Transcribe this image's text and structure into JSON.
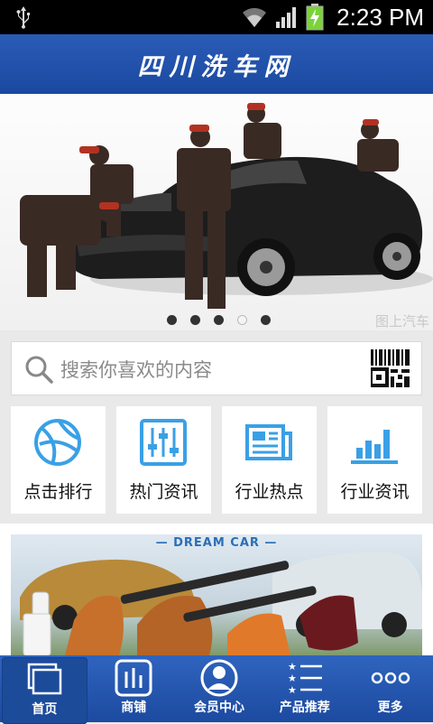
{
  "status_bar": {
    "time": "2:23 PM",
    "icons": [
      "usb-icon",
      "wifi-icon",
      "signal-icon",
      "battery-charging-icon"
    ]
  },
  "header": {
    "title": "四川洗车网"
  },
  "banner": {
    "watermark": "图上汽车",
    "slide_count": 5,
    "active_slide": 4
  },
  "search": {
    "placeholder": "搜索你喜欢的内容",
    "icon": "search-icon",
    "scan_icon": "qr-scan-icon"
  },
  "quick_links": [
    {
      "label": "点击排行",
      "icon": "basketball-icon"
    },
    {
      "label": "热门资讯",
      "icon": "sliders-icon"
    },
    {
      "label": "行业热点",
      "icon": "newspaper-icon"
    },
    {
      "label": "行业资讯",
      "icon": "bar-chart-icon"
    }
  ],
  "promo": {
    "title": "— DREAM CAR —"
  },
  "bottom_nav": [
    {
      "label": "首页",
      "icon": "home-windows-icon",
      "active": true
    },
    {
      "label": "商铺",
      "icon": "store-icon",
      "active": false
    },
    {
      "label": "会员中心",
      "icon": "user-icon",
      "active": false
    },
    {
      "label": "产品推荐",
      "icon": "star-list-icon",
      "active": false
    },
    {
      "label": "更多",
      "icon": "more-dots-icon",
      "active": false
    }
  ],
  "colors": {
    "brand_blue": "#2a5bb6",
    "icon_blue": "#3aa0e6",
    "status_bar": "#000000",
    "battery_green": "#7ad33a"
  }
}
